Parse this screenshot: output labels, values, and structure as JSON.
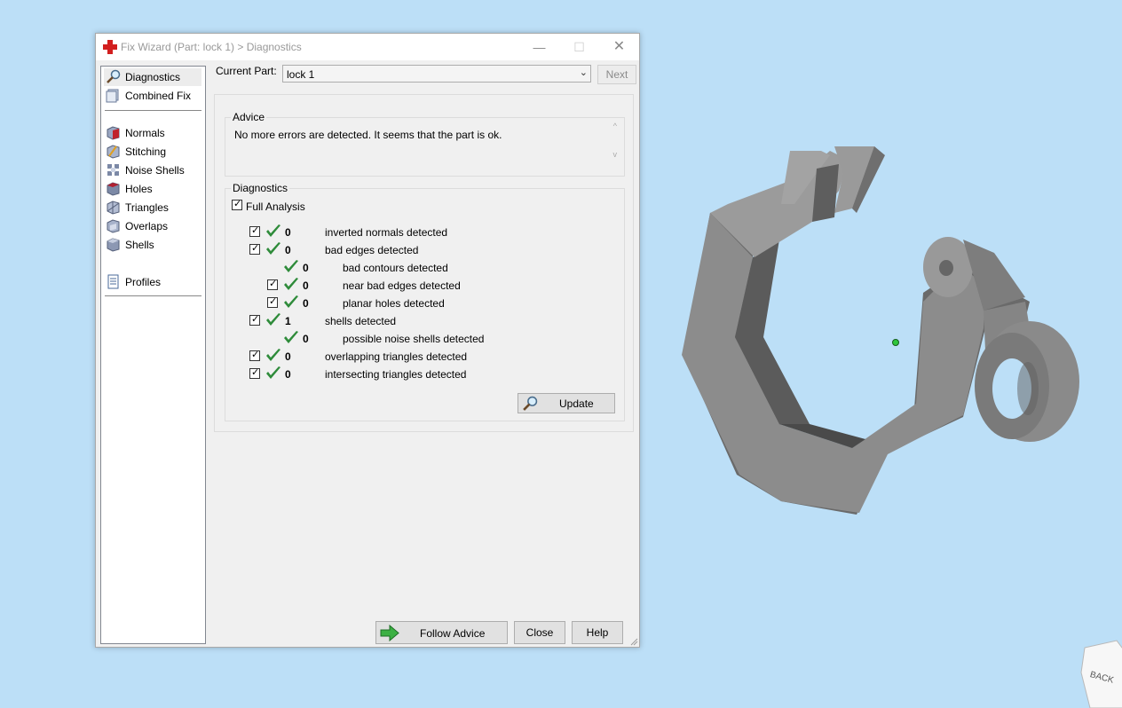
{
  "window": {
    "title": "Fix Wizard (Part: lock 1) > Diagnostics",
    "minimize_glyph": "—",
    "maximize_glyph": "☐",
    "close_glyph": "✕"
  },
  "sidebar": {
    "items": [
      {
        "label": "Diagnostics",
        "icon": "magnifier-icon"
      },
      {
        "label": "Combined Fix",
        "icon": "combined-fix-icon"
      },
      {
        "label": "Normals",
        "icon": "normals-icon"
      },
      {
        "label": "Stitching",
        "icon": "stitching-icon"
      },
      {
        "label": "Noise Shells",
        "icon": "noise-shells-icon"
      },
      {
        "label": "Holes",
        "icon": "holes-icon"
      },
      {
        "label": "Triangles",
        "icon": "triangles-icon"
      },
      {
        "label": "Overlaps",
        "icon": "overlaps-icon"
      },
      {
        "label": "Shells",
        "icon": "shells-icon"
      },
      {
        "label": "Profiles",
        "icon": "document-icon"
      }
    ]
  },
  "current_part": {
    "label": "Current Part:",
    "value": "lock 1",
    "next_label": "Next"
  },
  "advice": {
    "legend": "Advice",
    "text": "No more errors are detected. It seems that the part is ok.",
    "scroll_up": "^",
    "scroll_down": "v"
  },
  "diagnostics": {
    "legend": "Diagnostics",
    "full_analysis_label": "Full Analysis",
    "rows": [
      {
        "count": "0",
        "label": "inverted normals detected",
        "has_checkbox": true
      },
      {
        "count": "0",
        "label": "bad edges detected",
        "has_checkbox": true
      },
      {
        "count": "0",
        "label": "bad contours detected",
        "has_checkbox": false
      },
      {
        "count": "0",
        "label": "near bad edges detected",
        "has_checkbox": true
      },
      {
        "count": "0",
        "label": "planar holes detected",
        "has_checkbox": true
      },
      {
        "count": "1",
        "label": "shells detected",
        "has_checkbox": true
      },
      {
        "count": "0",
        "label": "possible noise shells detected",
        "has_checkbox": false
      },
      {
        "count": "0",
        "label": "overlapping triangles detected",
        "has_checkbox": true
      },
      {
        "count": "0",
        "label": "intersecting triangles detected",
        "has_checkbox": true
      }
    ],
    "update_label": "Update"
  },
  "footer": {
    "follow_advice_label": "Follow Advice",
    "close_label": "Close",
    "help_label": "Help"
  },
  "viewport": {
    "background": "#bcdff7",
    "part_color": "#808080",
    "nav_cube_label": "BACK"
  },
  "colors": {
    "check_green": "#2e8b3a",
    "arrow_green": "#3cb043",
    "title_icon_red": "#d21f1f"
  }
}
